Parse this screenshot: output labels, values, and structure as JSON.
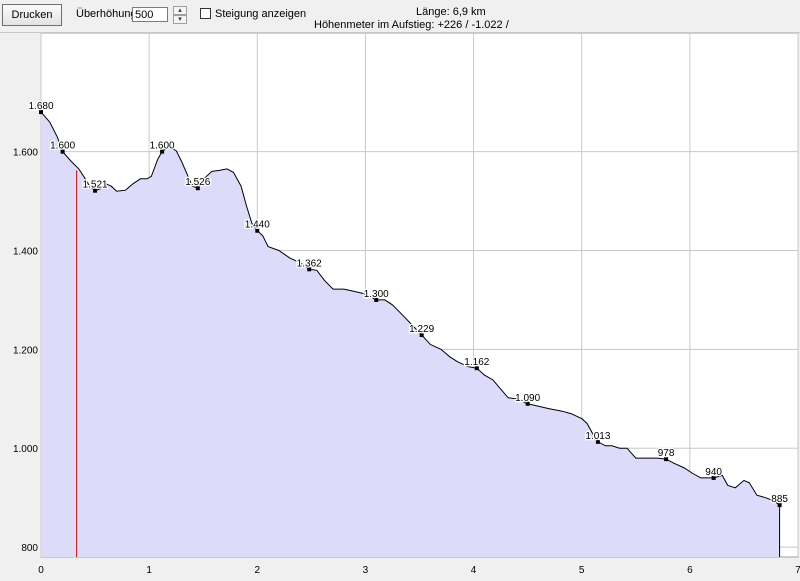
{
  "toolbar": {
    "print_label": "Drucken",
    "exaggeration_label": "Überhöhung",
    "exaggeration_value": "500",
    "slope_checkbox_label": "Steigung anzeigen",
    "slope_checked": false,
    "length_text": "Länge: 6,9 km",
    "ascent_text": "Höhenmeter im Aufstieg: +226 / -1.022 /"
  },
  "colors": {
    "fill": "#dcdcfa",
    "line": "#000000",
    "marker": "#c00000",
    "grid": "#c8c8c8"
  },
  "chart_data": {
    "type": "area",
    "xlim": [
      0,
      7
    ],
    "ylim": [
      780,
      1840
    ],
    "x_ticks": [
      0,
      1,
      2,
      3,
      4,
      5,
      6,
      7
    ],
    "x_tick_labels": [
      "0",
      "1",
      "2",
      "3",
      "4",
      "5",
      "6",
      "7"
    ],
    "y_ticks": [
      800,
      1000,
      1200,
      1400,
      1600
    ],
    "y_tick_labels": [
      "800",
      "1.000",
      "1.200",
      "1.400",
      "1.600"
    ],
    "grid": true,
    "marker_x": 0.33,
    "profile": [
      [
        0.0,
        1680
      ],
      [
        0.08,
        1660
      ],
      [
        0.15,
        1630
      ],
      [
        0.2,
        1600
      ],
      [
        0.28,
        1580
      ],
      [
        0.35,
        1565
      ],
      [
        0.4,
        1548
      ],
      [
        0.45,
        1530
      ],
      [
        0.5,
        1521
      ],
      [
        0.55,
        1525
      ],
      [
        0.6,
        1535
      ],
      [
        0.65,
        1530
      ],
      [
        0.7,
        1520
      ],
      [
        0.78,
        1522
      ],
      [
        0.85,
        1535
      ],
      [
        0.92,
        1545
      ],
      [
        0.98,
        1545
      ],
      [
        1.02,
        1550
      ],
      [
        1.08,
        1585
      ],
      [
        1.12,
        1600
      ],
      [
        1.18,
        1610
      ],
      [
        1.25,
        1602
      ],
      [
        1.3,
        1580
      ],
      [
        1.35,
        1555
      ],
      [
        1.4,
        1530
      ],
      [
        1.45,
        1526
      ],
      [
        1.52,
        1548
      ],
      [
        1.58,
        1560
      ],
      [
        1.65,
        1562
      ],
      [
        1.72,
        1565
      ],
      [
        1.78,
        1558
      ],
      [
        1.85,
        1530
      ],
      [
        1.9,
        1490
      ],
      [
        1.95,
        1455
      ],
      [
        2.0,
        1440
      ],
      [
        2.05,
        1430
      ],
      [
        2.1,
        1408
      ],
      [
        2.2,
        1400
      ],
      [
        2.3,
        1385
      ],
      [
        2.4,
        1375
      ],
      [
        2.48,
        1362
      ],
      [
        2.55,
        1360
      ],
      [
        2.62,
        1340
      ],
      [
        2.7,
        1322
      ],
      [
        2.8,
        1322
      ],
      [
        2.88,
        1318
      ],
      [
        3.0,
        1312
      ],
      [
        3.1,
        1300
      ],
      [
        3.18,
        1300
      ],
      [
        3.25,
        1290
      ],
      [
        3.35,
        1268
      ],
      [
        3.45,
        1245
      ],
      [
        3.52,
        1229
      ],
      [
        3.6,
        1210
      ],
      [
        3.7,
        1200
      ],
      [
        3.78,
        1185
      ],
      [
        3.85,
        1175
      ],
      [
        3.95,
        1165
      ],
      [
        4.03,
        1162
      ],
      [
        4.1,
        1148
      ],
      [
        4.18,
        1138
      ],
      [
        4.25,
        1120
      ],
      [
        4.32,
        1102
      ],
      [
        4.4,
        1100
      ],
      [
        4.5,
        1090
      ],
      [
        4.6,
        1085
      ],
      [
        4.7,
        1080
      ],
      [
        4.82,
        1075
      ],
      [
        4.9,
        1070
      ],
      [
        5.0,
        1060
      ],
      [
        5.05,
        1050
      ],
      [
        5.1,
        1030
      ],
      [
        5.15,
        1013
      ],
      [
        5.22,
        1005
      ],
      [
        5.28,
        1005
      ],
      [
        5.35,
        1000
      ],
      [
        5.42,
        1000
      ],
      [
        5.5,
        980
      ],
      [
        5.6,
        980
      ],
      [
        5.7,
        980
      ],
      [
        5.78,
        978
      ],
      [
        5.85,
        970
      ],
      [
        5.95,
        960
      ],
      [
        6.02,
        950
      ],
      [
        6.1,
        940
      ],
      [
        6.22,
        940
      ],
      [
        6.3,
        945
      ],
      [
        6.35,
        925
      ],
      [
        6.42,
        920
      ],
      [
        6.5,
        935
      ],
      [
        6.55,
        930
      ],
      [
        6.62,
        905
      ],
      [
        6.7,
        900
      ],
      [
        6.78,
        893
      ],
      [
        6.83,
        885
      ],
      [
        6.83,
        780
      ]
    ],
    "labels": [
      {
        "x": 0.0,
        "y": 1680,
        "text": "1.680"
      },
      {
        "x": 0.2,
        "y": 1600,
        "text": "1.600"
      },
      {
        "x": 0.5,
        "y": 1521,
        "text": "1.521"
      },
      {
        "x": 1.12,
        "y": 1600,
        "text": "1.600"
      },
      {
        "x": 1.45,
        "y": 1526,
        "text": "1.526"
      },
      {
        "x": 2.0,
        "y": 1440,
        "text": "1.440"
      },
      {
        "x": 2.48,
        "y": 1362,
        "text": "1.362"
      },
      {
        "x": 3.1,
        "y": 1300,
        "text": "1.300"
      },
      {
        "x": 3.52,
        "y": 1229,
        "text": "1.229"
      },
      {
        "x": 4.03,
        "y": 1162,
        "text": "1.162"
      },
      {
        "x": 4.5,
        "y": 1090,
        "text": "1.090"
      },
      {
        "x": 5.15,
        "y": 1013,
        "text": "1.013"
      },
      {
        "x": 5.78,
        "y": 978,
        "text": "978"
      },
      {
        "x": 6.22,
        "y": 940,
        "text": "940"
      },
      {
        "x": 6.83,
        "y": 885,
        "text": "885"
      }
    ]
  }
}
